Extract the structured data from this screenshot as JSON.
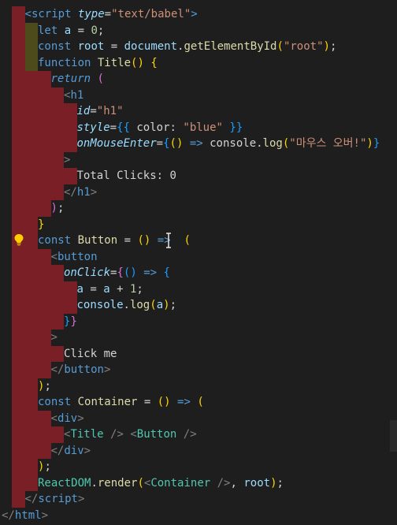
{
  "editor": {
    "language": "html-jsx",
    "colors": {
      "background": "#1e1e1e",
      "indent_guide_error": "#7a1f25",
      "indent_guide_alt": "#4d4a1b",
      "indent_guide_green": "#1f3f25"
    },
    "lines": [
      {
        "indent": 0,
        "tokens": [
          [
            "t-tag",
            "<"
          ],
          [
            "t-tag",
            "script"
          ],
          [
            "t-text",
            " "
          ],
          [
            "t-attr-i",
            "type"
          ],
          [
            "t-text",
            "="
          ],
          [
            "t-str",
            "\"text/babel\""
          ],
          [
            "t-tag",
            ">"
          ]
        ]
      },
      {
        "indent": 1,
        "tokens": [
          [
            "t-kw",
            "let"
          ],
          [
            "t-text",
            " "
          ],
          [
            "t-var",
            "a"
          ],
          [
            "t-op",
            " = "
          ],
          [
            "t-num",
            "0"
          ],
          [
            "t-text",
            ";"
          ]
        ]
      },
      {
        "indent": 1,
        "tokens": [
          [
            "t-kw",
            "const"
          ],
          [
            "t-text",
            " "
          ],
          [
            "t-var",
            "root"
          ],
          [
            "t-op",
            " = "
          ],
          [
            "t-var",
            "document"
          ],
          [
            "t-text",
            "."
          ],
          [
            "t-fn",
            "getElementById"
          ],
          [
            "t-brace",
            "("
          ],
          [
            "t-str",
            "\"root\""
          ],
          [
            "t-brace",
            ")"
          ],
          [
            "t-text",
            ";"
          ]
        ]
      },
      {
        "indent": 1,
        "tokens": [
          [
            "t-kw",
            "function"
          ],
          [
            "t-text",
            " "
          ],
          [
            "t-fn",
            "Title"
          ],
          [
            "t-brace",
            "()"
          ],
          [
            "t-text",
            " "
          ],
          [
            "t-brace",
            "{"
          ]
        ]
      },
      {
        "indent": 2,
        "tokens": [
          [
            "t-kw-i",
            "return"
          ],
          [
            "t-text",
            " "
          ],
          [
            "t-brace2",
            "("
          ]
        ]
      },
      {
        "indent": 3,
        "tokens": [
          [
            "t-punc",
            "<"
          ],
          [
            "t-tag",
            "h1"
          ]
        ]
      },
      {
        "indent": 4,
        "tokens": [
          [
            "t-attr-i",
            "id"
          ],
          [
            "t-text",
            "="
          ],
          [
            "t-str",
            "\"h1\""
          ]
        ]
      },
      {
        "indent": 4,
        "tokens": [
          [
            "t-attr-i",
            "style"
          ],
          [
            "t-text",
            "="
          ],
          [
            "t-brace3",
            "{{"
          ],
          [
            "t-text",
            " color: "
          ],
          [
            "t-str",
            "\"blue\""
          ],
          [
            "t-text",
            " "
          ],
          [
            "t-brace3",
            "}}"
          ]
        ]
      },
      {
        "indent": 4,
        "tokens": [
          [
            "t-attr-i",
            "onMouseEnter"
          ],
          [
            "t-text",
            "="
          ],
          [
            "t-brace3",
            "{"
          ],
          [
            "t-brace",
            "()"
          ],
          [
            "t-text",
            " "
          ],
          [
            "t-kw",
            "=>"
          ],
          [
            "t-text",
            " console."
          ],
          [
            "t-fn",
            "log"
          ],
          [
            "t-brace",
            "("
          ],
          [
            "t-str",
            "\"마우스 오버!\""
          ],
          [
            "t-brace",
            ")"
          ],
          [
            "t-brace3",
            "}"
          ]
        ]
      },
      {
        "indent": 3,
        "tokens": [
          [
            "t-punc",
            ">"
          ]
        ]
      },
      {
        "indent": 4,
        "tokens": [
          [
            "t-text",
            "Total Clicks: 0"
          ]
        ]
      },
      {
        "indent": 3,
        "tokens": [
          [
            "t-punc",
            "</"
          ],
          [
            "t-tag",
            "h1"
          ],
          [
            "t-punc",
            ">"
          ]
        ]
      },
      {
        "indent": 2,
        "tokens": [
          [
            "t-brace2",
            ")"
          ],
          [
            "t-text",
            ";"
          ]
        ]
      },
      {
        "indent": 1,
        "tokens": [
          [
            "t-brace",
            "}"
          ]
        ]
      },
      {
        "indent": 1,
        "tokens": [
          [
            "t-kw",
            "const"
          ],
          [
            "t-text",
            " "
          ],
          [
            "t-fn",
            "Button"
          ],
          [
            "t-op",
            " = "
          ],
          [
            "t-brace",
            "()"
          ],
          [
            "t-text",
            " "
          ],
          [
            "t-kw",
            "=>"
          ],
          [
            "t-text",
            "  "
          ],
          [
            "t-brace",
            "("
          ]
        ]
      },
      {
        "indent": 2,
        "tokens": [
          [
            "t-punc",
            "<"
          ],
          [
            "t-tag",
            "button"
          ]
        ]
      },
      {
        "indent": 3,
        "tokens": [
          [
            "t-attr-i",
            "onClick"
          ],
          [
            "t-text",
            "="
          ],
          [
            "t-brace2",
            "{"
          ],
          [
            "t-brace3",
            "()"
          ],
          [
            "t-text",
            " "
          ],
          [
            "t-kw",
            "=>"
          ],
          [
            "t-text",
            " "
          ],
          [
            "t-brace3",
            "{"
          ]
        ]
      },
      {
        "indent": 4,
        "tokens": [
          [
            "t-var",
            "a"
          ],
          [
            "t-op",
            " = "
          ],
          [
            "t-var",
            "a"
          ],
          [
            "t-op",
            " + "
          ],
          [
            "t-num",
            "1"
          ],
          [
            "t-text",
            ";"
          ]
        ]
      },
      {
        "indent": 4,
        "tokens": [
          [
            "t-var",
            "console"
          ],
          [
            "t-text",
            "."
          ],
          [
            "t-fn",
            "log"
          ],
          [
            "t-brace",
            "("
          ],
          [
            "t-var",
            "a"
          ],
          [
            "t-brace",
            ")"
          ],
          [
            "t-text",
            ";"
          ]
        ]
      },
      {
        "indent": 3,
        "tokens": [
          [
            "t-brace3",
            "}"
          ],
          [
            "t-brace2",
            "}"
          ]
        ]
      },
      {
        "indent": 2,
        "tokens": [
          [
            "t-punc",
            ">"
          ]
        ]
      },
      {
        "indent": 3,
        "tokens": [
          [
            "t-text",
            "Click me"
          ]
        ]
      },
      {
        "indent": 2,
        "tokens": [
          [
            "t-punc",
            "</"
          ],
          [
            "t-tag",
            "button"
          ],
          [
            "t-punc",
            ">"
          ]
        ]
      },
      {
        "indent": 1,
        "tokens": [
          [
            "t-brace",
            ")"
          ],
          [
            "t-text",
            ";"
          ]
        ]
      },
      {
        "indent": 1,
        "tokens": [
          [
            "t-kw",
            "const"
          ],
          [
            "t-text",
            " "
          ],
          [
            "t-fn",
            "Container"
          ],
          [
            "t-op",
            " = "
          ],
          [
            "t-brace",
            "()"
          ],
          [
            "t-text",
            " "
          ],
          [
            "t-kw",
            "=>"
          ],
          [
            "t-text",
            " "
          ],
          [
            "t-brace",
            "("
          ]
        ]
      },
      {
        "indent": 2,
        "tokens": [
          [
            "t-punc",
            "<"
          ],
          [
            "t-tag",
            "div"
          ],
          [
            "t-punc",
            ">"
          ]
        ]
      },
      {
        "indent": 3,
        "tokens": [
          [
            "t-punc",
            "<"
          ],
          [
            "t-comp",
            "Title"
          ],
          [
            "t-text",
            " "
          ],
          [
            "t-punc",
            "/>"
          ],
          [
            "t-text",
            " "
          ],
          [
            "t-punc",
            "<"
          ],
          [
            "t-comp",
            "Button"
          ],
          [
            "t-text",
            " "
          ],
          [
            "t-punc",
            "/>"
          ]
        ]
      },
      {
        "indent": 2,
        "tokens": [
          [
            "t-punc",
            "</"
          ],
          [
            "t-tag",
            "div"
          ],
          [
            "t-punc",
            ">"
          ]
        ]
      },
      {
        "indent": 1,
        "tokens": [
          [
            "t-brace",
            ")"
          ],
          [
            "t-text",
            ";"
          ]
        ]
      },
      {
        "indent": 1,
        "tokens": [
          [
            "t-comp",
            "ReactDOM"
          ],
          [
            "t-text",
            "."
          ],
          [
            "t-fn",
            "render"
          ],
          [
            "t-brace",
            "("
          ],
          [
            "t-punc",
            "<"
          ],
          [
            "t-comp",
            "Container"
          ],
          [
            "t-text",
            " "
          ],
          [
            "t-punc",
            "/>"
          ],
          [
            "t-text",
            ", "
          ],
          [
            "t-var",
            "root"
          ],
          [
            "t-brace",
            ")"
          ],
          [
            "t-text",
            ";"
          ]
        ]
      },
      {
        "indent": 0,
        "tokens": [
          [
            "t-punc",
            "</"
          ],
          [
            "t-tag",
            "script"
          ],
          [
            "t-punc",
            ">"
          ]
        ]
      },
      {
        "indent": -1,
        "tokens": [
          [
            "t-punc",
            "</"
          ],
          [
            "t-tag",
            "html"
          ],
          [
            "t-punc",
            ">"
          ]
        ]
      }
    ]
  },
  "lightbulb_icon": "lightbulb-icon",
  "text_cursor_icon": "i-beam-cursor-icon"
}
